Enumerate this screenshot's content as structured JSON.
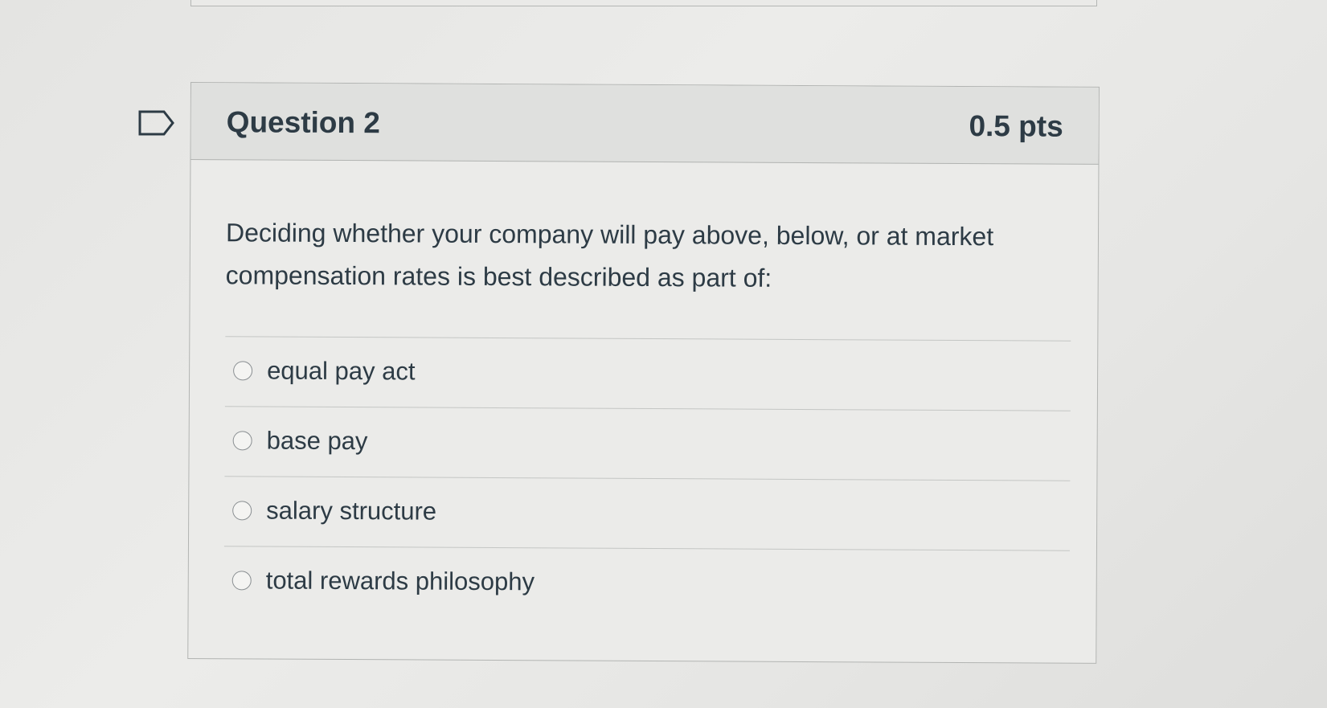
{
  "question": {
    "title": "Question 2",
    "points": "0.5 pts",
    "text": "Deciding whether your company will pay above, below, or at market compensation rates is best described as part of:",
    "answers": [
      {
        "label": "equal pay act"
      },
      {
        "label": "base pay"
      },
      {
        "label": "salary structure"
      },
      {
        "label": "total rewards philosophy"
      }
    ]
  },
  "icons": {
    "flag": "flag-question-icon",
    "radio": "radio-unselected-icon"
  },
  "colors": {
    "text": "#2d3b45",
    "header_bg": "#dfe0de",
    "border": "#b2b4b2"
  }
}
